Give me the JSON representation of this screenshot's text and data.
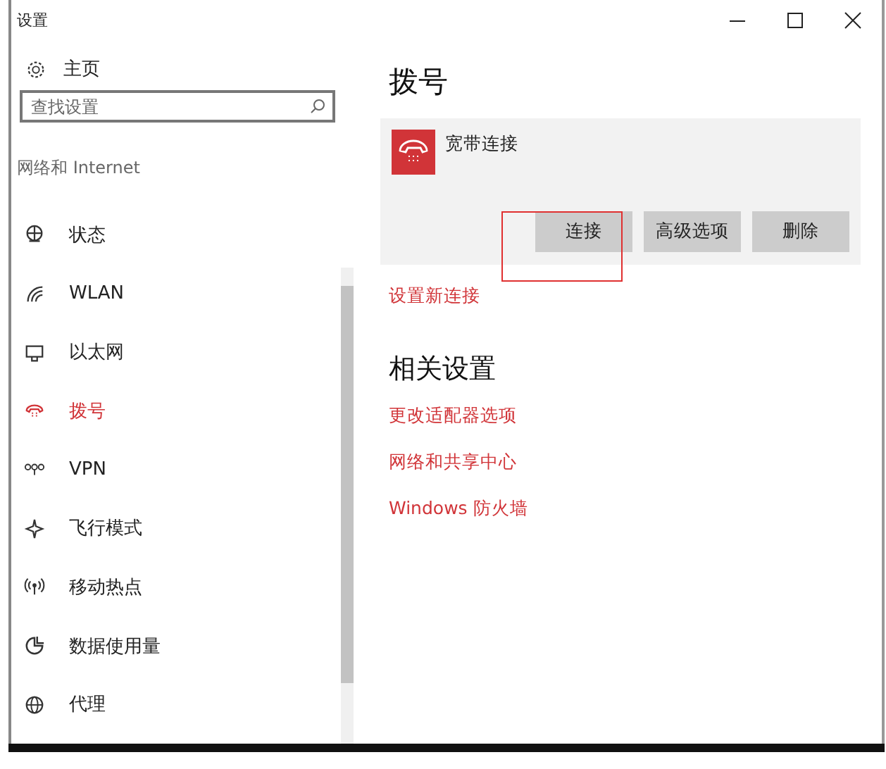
{
  "window": {
    "title": "设置"
  },
  "sidebar": {
    "home": "主页",
    "search": {
      "placeholder": "查找设置"
    },
    "section": "网络和 Internet",
    "items": [
      {
        "label": "状态",
        "selected": false
      },
      {
        "label": "WLAN",
        "selected": false
      },
      {
        "label": "以太网",
        "selected": false
      },
      {
        "label": "拨号",
        "selected": true
      },
      {
        "label": "VPN",
        "selected": false
      },
      {
        "label": "飞行模式",
        "selected": false
      },
      {
        "label": "移动热点",
        "selected": false
      },
      {
        "label": "数据使用量",
        "selected": false
      },
      {
        "label": "代理",
        "selected": false
      }
    ]
  },
  "page": {
    "title": "拨号",
    "connection": {
      "name": "宽带连接",
      "buttons": [
        {
          "label": "连接",
          "highlighted": true
        },
        {
          "label": "高级选项",
          "highlighted": false
        },
        {
          "label": "删除",
          "highlighted": false
        }
      ]
    },
    "new_connection_link": "设置新连接",
    "related": {
      "title": "相关设置",
      "links": [
        "更改适配器选项",
        "网络和共享中心",
        "Windows 防火墙"
      ]
    }
  }
}
